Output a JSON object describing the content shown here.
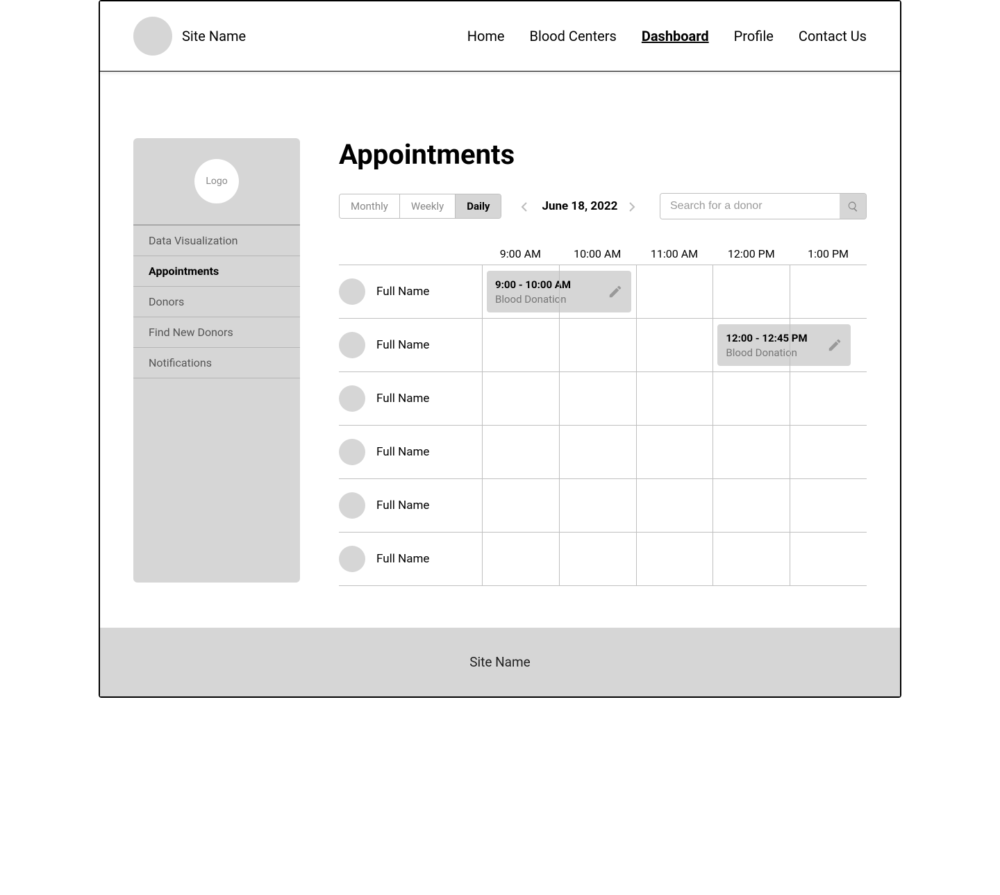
{
  "header": {
    "site_name": "Site Name",
    "nav": {
      "home": "Home",
      "blood_centers": "Blood Centers",
      "dashboard": "Dashboard",
      "profile": "Profile",
      "contact_us": "Contact Us"
    }
  },
  "sidebar": {
    "logo_label": "Logo",
    "items": [
      {
        "label": "Data Visualization"
      },
      {
        "label": "Appointments"
      },
      {
        "label": "Donors"
      },
      {
        "label": "Find New Donors"
      },
      {
        "label": "Notifications"
      }
    ]
  },
  "main": {
    "title": "Appointments",
    "view_toggle": {
      "monthly": "Monthly",
      "weekly": "Weekly",
      "daily": "Daily"
    },
    "date": "June 18, 2022",
    "search_placeholder": "Search for a donor",
    "time_headers": [
      "9:00 AM",
      "10:00 AM",
      "11:00 AM",
      "12:00 PM",
      "1:00 PM"
    ],
    "rows": [
      {
        "name": "Full Name"
      },
      {
        "name": "Full Name"
      },
      {
        "name": "Full Name"
      },
      {
        "name": "Full Name"
      },
      {
        "name": "Full Name"
      },
      {
        "name": "Full Name"
      }
    ],
    "appointments": [
      {
        "time": "9:00 - 10:00 AM",
        "label": "Blood Donation"
      },
      {
        "time": "12:00 - 12:45 PM",
        "label": "Blood Donation"
      }
    ]
  },
  "footer": {
    "site_name": "Site Name"
  }
}
